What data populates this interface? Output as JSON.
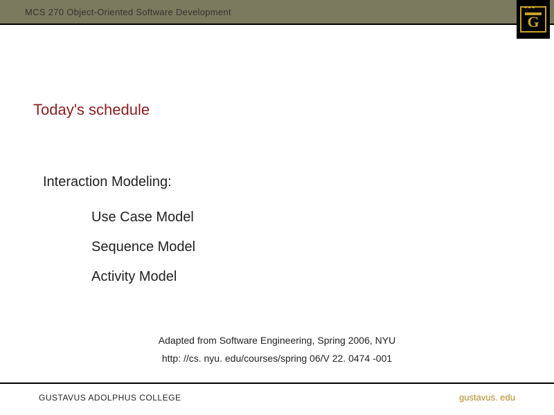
{
  "header": {
    "course_title": "MCS 270 Object-Oriented Software Development"
  },
  "slide": {
    "title": "Today's schedule",
    "section_label": "Interaction Modeling:",
    "bullets": [
      "Use Case Model",
      "Sequence Model",
      "Activity Model"
    ]
  },
  "attribution": {
    "line1": "Adapted from Software Engineering, Spring 2006, NYU",
    "line2": "http: //cs. nyu. edu/courses/spring 06/V 22. 0474 -001"
  },
  "footer": {
    "college": "GUSTAVUS ADOLPHUS COLLEGE",
    "url": "gustavus. edu"
  },
  "colors": {
    "header_bg": "#7b7a5e",
    "title_color": "#8a1e1e",
    "accent_gold": "#c9a227"
  }
}
